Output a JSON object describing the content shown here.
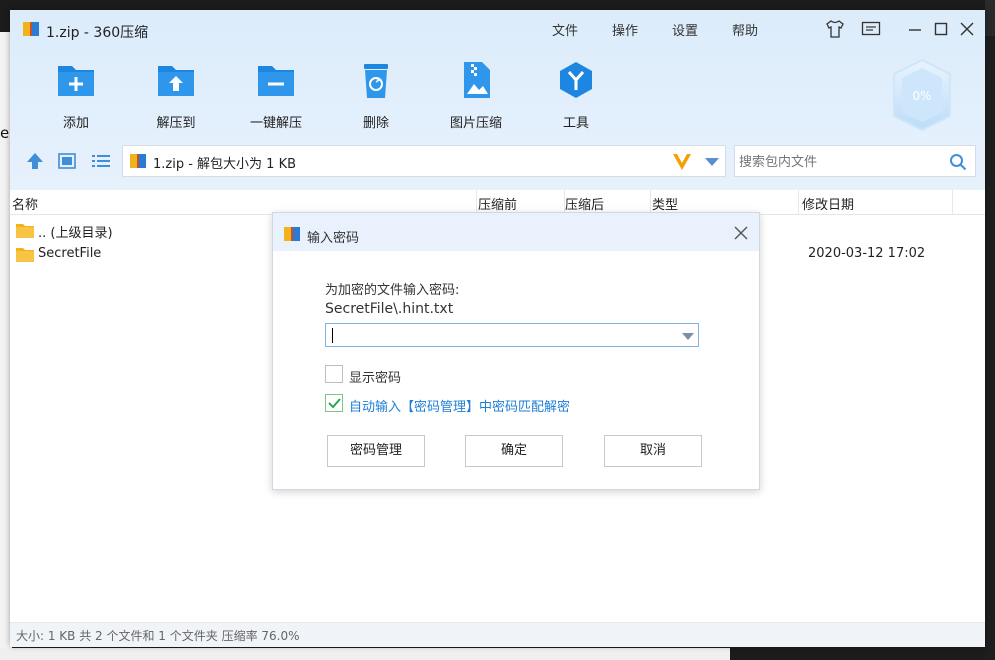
{
  "window": {
    "title": "1.zip - 360压缩",
    "menu": [
      "文件",
      "操作",
      "设置",
      "帮助"
    ]
  },
  "toolbar": {
    "items": [
      {
        "label": "添加",
        "icon": "add-icon"
      },
      {
        "label": "解压到",
        "icon": "extract-to-icon"
      },
      {
        "label": "一键解压",
        "icon": "one-click-extract-icon"
      },
      {
        "label": "删除",
        "icon": "delete-icon"
      },
      {
        "label": "图片压缩",
        "icon": "image-compress-icon"
      },
      {
        "label": "工具",
        "icon": "tools-icon"
      }
    ],
    "badge_percent": "0%"
  },
  "address": {
    "text": "1.zip - 解包大小为 1 KB"
  },
  "search": {
    "placeholder": "搜索包内文件"
  },
  "columns": [
    "名称",
    "压缩前",
    "压缩后",
    "类型",
    "修改日期"
  ],
  "files": [
    {
      "name": ".. (上级目录)",
      "modified": ""
    },
    {
      "name": "SecretFile",
      "modified": "2020-03-12 17:02"
    }
  ],
  "status": "大小: 1 KB 共 2 个文件和 1 个文件夹 压缩率 76.0%",
  "dialog": {
    "title": "输入密码",
    "prompt": "为加密的文件输入密码:",
    "file": "SecretFile\\.hint.txt",
    "password_value": "",
    "show_password_label": "显示密码",
    "show_password_checked": false,
    "auto_fill_label": "自动输入【密码管理】中密码匹配解密",
    "auto_fill_checked": true,
    "buttons": {
      "manage": "密码管理",
      "ok": "确定",
      "cancel": "取消"
    }
  },
  "background": {
    "left_fragment": "e"
  },
  "colors": {
    "header_bg": "#dcecfb",
    "icon_blue": "#1d86e0",
    "link_blue": "#1e7fd6",
    "check_green": "#1aa34a",
    "v_logo": "#f5a000"
  }
}
